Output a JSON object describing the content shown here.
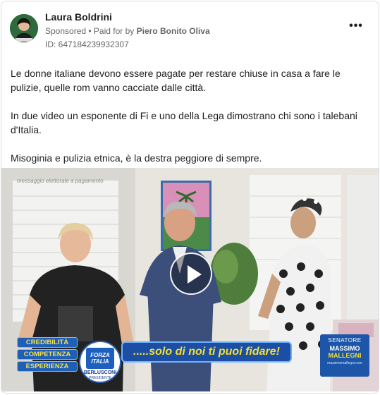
{
  "post": {
    "author": "Laura Boldrini",
    "sponsored_label": "Sponsored",
    "paid_for_prefix": "• Paid for by",
    "payer": "Piero Bonito Oliva",
    "ad_id": "ID: 647184239932307",
    "more_icon": "more-options-icon"
  },
  "body": {
    "paragraphs": [
      "Le donne italiane devono essere pagate per restare chiuse in casa a fare le pulizie, quelle rom vanno cacciate dalle città.",
      "In due video un esponente di Fi e uno della Lega dimostrano chi sono i talebani d'Italia.",
      "Misoginia e pulizia etnica, è la destra peggiore di sempre."
    ]
  },
  "video": {
    "watermark": "messaggio elettorale a pagamento",
    "play_icon": "play-icon",
    "banner_pills": [
      "CREDIBILITÀ",
      "COMPETENZA",
      "ESPERIENZA"
    ],
    "logo_top": "FORZA ITALIA",
    "logo_name": "BERLUSCONI",
    "logo_sub": "PRESIDENTE",
    "slogan": ".....solo di noi ti puoi fidare!",
    "senator_title": "SENATORE",
    "senator_first": "MASSIMO",
    "senator_last": "MALLEGNI",
    "senator_site": "massimomallegni.com"
  },
  "colors": {
    "brand_blue": "#1c4fa4",
    "slogan_yellow": "#f5de2e",
    "text_secondary": "#65676b"
  }
}
